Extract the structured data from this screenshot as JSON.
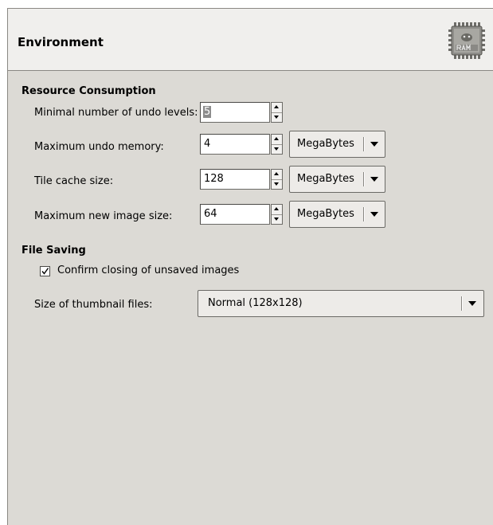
{
  "header": {
    "title": "Environment",
    "icon": "ram-chip-icon"
  },
  "resource": {
    "title": "Resource Consumption",
    "undo_levels": {
      "label": "Minimal number of undo levels:",
      "value": "5"
    },
    "undo_memory": {
      "label": "Maximum undo memory:",
      "value": "4",
      "unit": "MegaBytes"
    },
    "tile_cache": {
      "label": "Tile cache size:",
      "value": "128",
      "unit": "MegaBytes"
    },
    "new_image": {
      "label": "Maximum new image size:",
      "value": "64",
      "unit": "MegaBytes"
    }
  },
  "saving": {
    "title": "File Saving",
    "confirm": {
      "label": "Confirm closing of unsaved images",
      "checked": true
    },
    "thumbnail": {
      "label": "Size of thumbnail files:",
      "value": "Normal (128x128)"
    }
  },
  "colors": {
    "panel_bg": "#dcdad5",
    "header_bg": "#f0efed"
  }
}
